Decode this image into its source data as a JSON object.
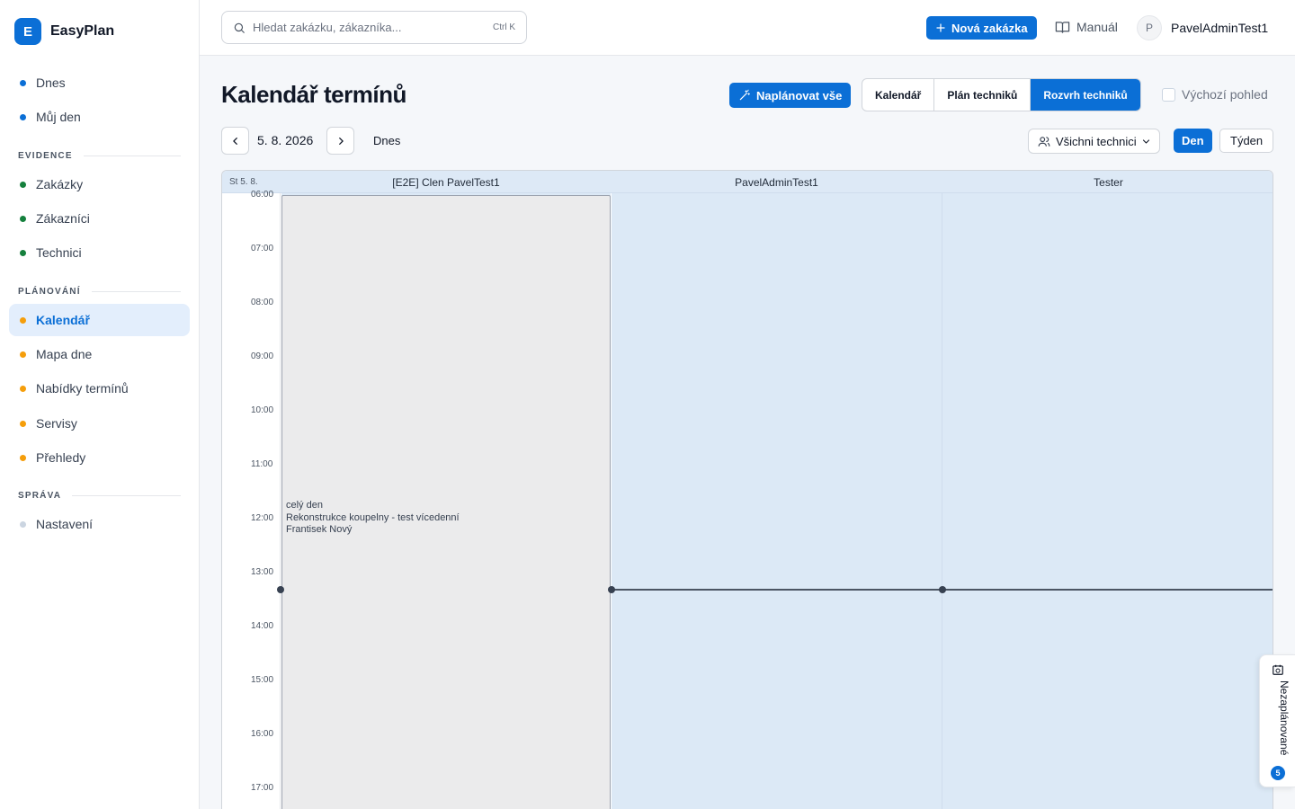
{
  "brand": {
    "logo_letter": "E",
    "name": "EasyPlan"
  },
  "sidebar": {
    "items": [
      {
        "label": "Dnes",
        "color": "#0b6fd6"
      },
      {
        "label": "Můj den",
        "color": "#0b6fd6"
      },
      {
        "label": "Zakázky",
        "color": "#15803d"
      },
      {
        "label": "Zákazníci",
        "color": "#15803d"
      },
      {
        "label": "Technici",
        "color": "#15803d"
      },
      {
        "label": "Kalendář",
        "color": "#f59e0b",
        "active": true
      },
      {
        "label": "Mapa dne",
        "color": "#f59e0b"
      },
      {
        "label": "Nabídky termínů",
        "color": "#f59e0b"
      },
      {
        "label": "Servisy",
        "color": "#f59e0b"
      },
      {
        "label": "Přehledy",
        "color": "#f59e0b"
      },
      {
        "label": "Nastavení",
        "color": "#cbd5e1"
      }
    ],
    "sections": {
      "evidence": "EVIDENCE",
      "planning": "PLÁNOVÁNÍ",
      "admin": "SPRÁVA"
    }
  },
  "topbar": {
    "search_placeholder": "Hledat zakázku, zákazníka...",
    "search_shortcut": "Ctrl K",
    "new_order_label": "Nová zakázka",
    "manual_label": "Manuál",
    "user_initial": "P",
    "user_name": "PavelAdminTest1"
  },
  "page": {
    "title": "Kalendář termínů",
    "plan_all_label": "Naplánovat vše",
    "views": [
      "Kalendář",
      "Plán techniků",
      "Rozvrh techniků"
    ],
    "active_view": "Rozvrh techniků",
    "default_view_label": "Výchozí pohled",
    "date": "5. 8. 2026",
    "today_label": "Dnes",
    "tech_filter_label": "Všichni technici",
    "day_label": "Den",
    "week_label": "Týden"
  },
  "calendar": {
    "day_header": "St 5. 8.",
    "columns": [
      "[E2E] Clen PavelTest1",
      "PavelAdminTest1",
      "Tester"
    ],
    "hours": [
      "06:00",
      "07:00",
      "08:00",
      "09:00",
      "10:00",
      "11:00",
      "12:00",
      "13:00",
      "14:00",
      "15:00",
      "16:00",
      "17:00"
    ],
    "event": {
      "line1": "celý den",
      "line2": "Rekonstrukce koupelny - test vícedenní",
      "line3": "Frantisek Nový"
    }
  },
  "unscheduled": {
    "label": "Nezaplánované",
    "count": "5"
  },
  "colors": {
    "accent": "#0b6fd6",
    "column_bg": "#dce9f6",
    "allday_bg": "#ebebec"
  }
}
